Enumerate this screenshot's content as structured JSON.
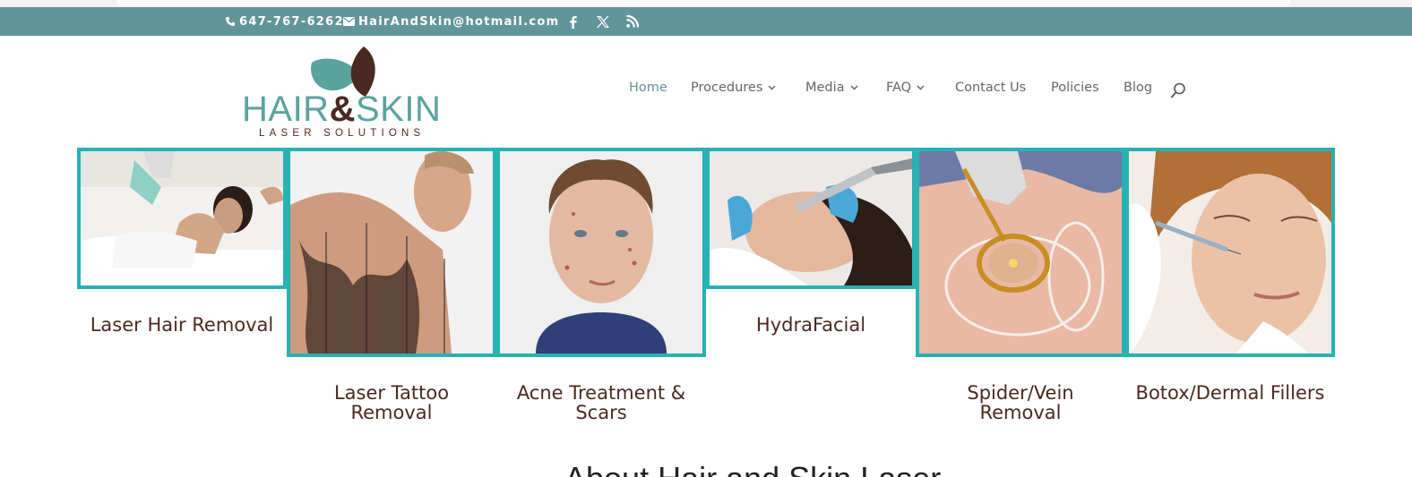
{
  "contact": {
    "phone": "647-767-6262",
    "email": "HairAndSkin@hotmail.com"
  },
  "social": [
    "facebook-icon",
    "x-twitter-icon",
    "rss-icon"
  ],
  "logo": {
    "brand_left": "HAIR",
    "brand_amp": "&",
    "brand_right": "SKIN",
    "tagline": "LASER SOLUTIONS"
  },
  "nav": {
    "items": [
      {
        "label": "Home",
        "active": true,
        "dropdown": false
      },
      {
        "label": "Procedures",
        "active": false,
        "dropdown": true
      },
      {
        "label": "Media",
        "active": false,
        "dropdown": true
      },
      {
        "label": "FAQ",
        "active": false,
        "dropdown": true
      },
      {
        "label": "Contact Us",
        "active": false,
        "dropdown": false
      },
      {
        "label": "Policies",
        "active": false,
        "dropdown": false
      },
      {
        "label": "Blog",
        "active": false,
        "dropdown": false
      }
    ]
  },
  "procedures": [
    {
      "label": "Laser Hair Removal"
    },
    {
      "label_line1": "Laser Tattoo",
      "label_line2": "Removal"
    },
    {
      "label_line1": "Acne Treatment &",
      "label_line2": "Scars"
    },
    {
      "label": "HydraFacial"
    },
    {
      "label_line1": "Spider/Vein",
      "label_line2": "Removal"
    },
    {
      "label": "Botox/Dermal Fillers"
    }
  ],
  "colors": {
    "bar": "#62959a",
    "tile_border": "#27b2b3",
    "label_brown": "#4a2a20",
    "nav_active": "#62959a"
  },
  "section_heading": "About Hair and Skin Laser"
}
